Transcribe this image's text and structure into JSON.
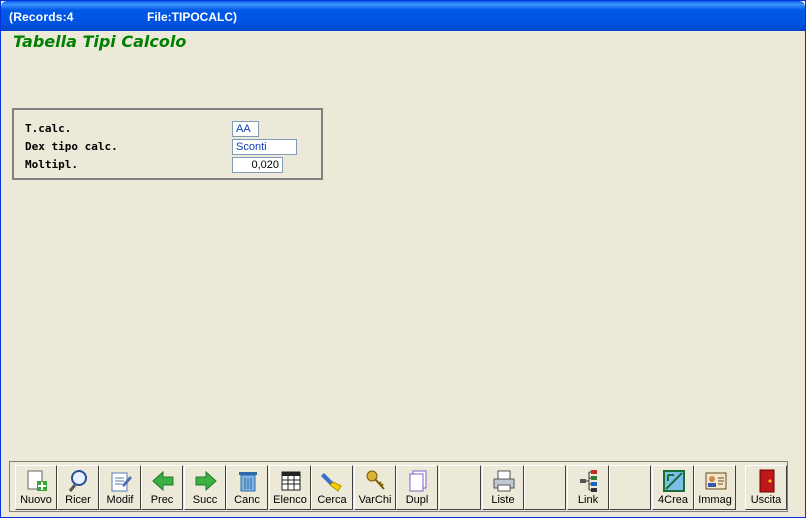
{
  "window": {
    "records": "(Records:4",
    "file": "File:TIPOCALC)"
  },
  "form": {
    "title": "Tabella Tipi Calcolo"
  },
  "fields": [
    {
      "label": "T.calc.",
      "value": "AA"
    },
    {
      "label": "Dex tipo calc.",
      "value": "Sconti"
    },
    {
      "label": "Moltipl.",
      "value": "0,020"
    }
  ],
  "toolbar": [
    {
      "label": "Nuovo",
      "icon": "new-record-icon"
    },
    {
      "label": "Ricer",
      "icon": "search-magnifier-icon"
    },
    {
      "label": "Modif",
      "icon": "edit-document-icon"
    },
    {
      "label": "Prec",
      "icon": "arrow-left-icon"
    },
    {
      "label": "Succ",
      "icon": "arrow-right-icon"
    },
    {
      "label": "Canc",
      "icon": "trash-icon"
    },
    {
      "label": "Elenco",
      "icon": "table-list-icon"
    },
    {
      "label": "Cerca",
      "icon": "flashlight-icon"
    },
    {
      "label": "VarChi",
      "icon": "keys-icon"
    },
    {
      "label": "Dupl",
      "icon": "duplicate-icon"
    },
    {
      "label": "",
      "icon": ""
    },
    {
      "label": "Liste",
      "icon": "printer-icon"
    },
    {
      "label": "",
      "icon": ""
    },
    {
      "label": "Link",
      "icon": "link-tree-icon"
    },
    {
      "label": "",
      "icon": ""
    },
    {
      "label": "4Crea",
      "icon": "create-icon"
    },
    {
      "label": "Immag",
      "icon": "image-card-icon"
    },
    {
      "label": "Uscita",
      "icon": "exit-door-icon"
    }
  ],
  "colors": {
    "title_bar": "#0054E3",
    "form_title": "#008000",
    "background": "#ECE9D8"
  }
}
